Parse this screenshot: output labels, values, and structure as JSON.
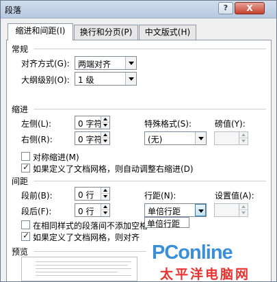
{
  "window": {
    "title": "段落",
    "help": "?",
    "close": "X"
  },
  "tabs": [
    {
      "label": "缩进和间距(I)"
    },
    {
      "label": "换行和分页(P)"
    },
    {
      "label": "中文版式(H)"
    }
  ],
  "general": {
    "heading": "常规",
    "alignment_label": "对齐方式(G):",
    "alignment_value": "两端对齐",
    "outline_label": "大纲级别(O):",
    "outline_value": "1 级"
  },
  "indent": {
    "heading": "缩进",
    "left_label": "左侧(L):",
    "left_value": "0 字符",
    "right_label": "右侧(R):",
    "right_value": "0 字符",
    "special_label": "特殊格式(S):",
    "special_value": "(无)",
    "by_label": "磅值(Y):",
    "by_value": "",
    "mirror_label": "对称缩进(M)",
    "mirror_checked": false,
    "auto_adjust_label": "如果定义了文档网格，则自动调整右缩进(D)",
    "auto_adjust_checked": true
  },
  "spacing": {
    "heading": "间距",
    "before_label": "段前(B):",
    "before_value": "0 行",
    "after_label": "段后(F):",
    "after_value": "0 行",
    "line_label": "行距(N):",
    "line_value": "单倍行距",
    "at_label": "设置值(A):",
    "at_value": "",
    "dropdown_option": "单倍行距",
    "no_space_label": "在相同样式的段落间不添加空格",
    "no_space_checked": false,
    "snap_label": "如果定义了文档网格，则对齐",
    "snap_checked": true
  },
  "preview": {
    "heading": "预览"
  },
  "watermark": {
    "logo": "PConline",
    "tagline": "太平洋电脑网"
  }
}
